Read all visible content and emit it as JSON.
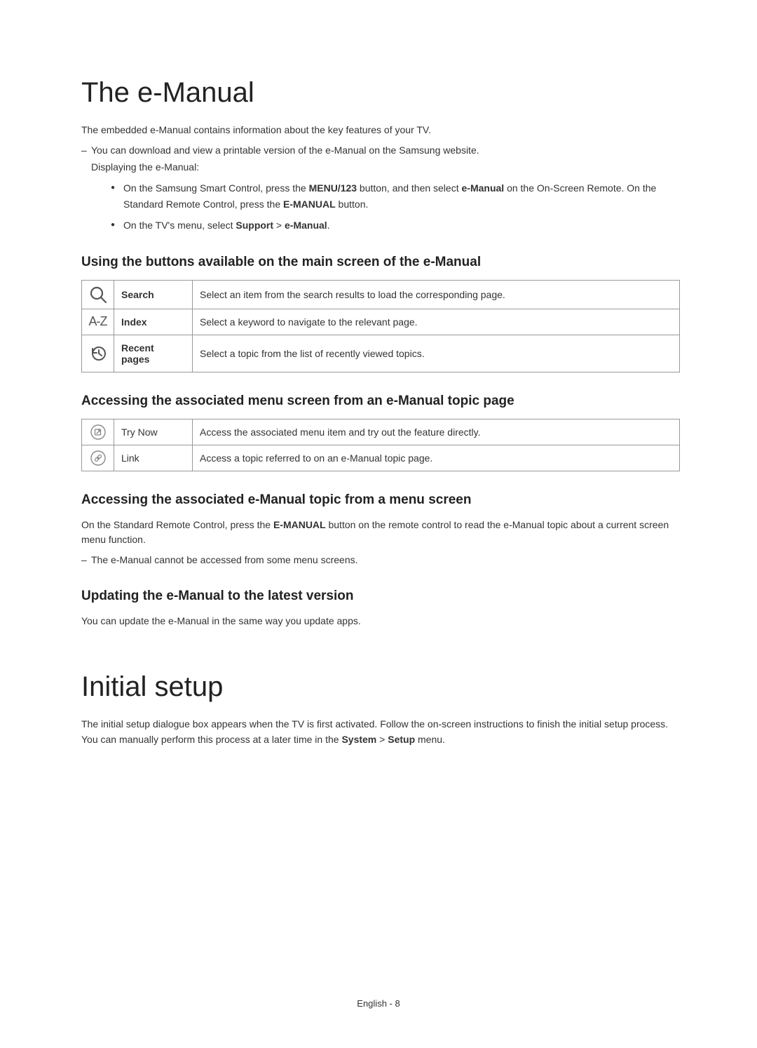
{
  "h1_emanual": "The e-Manual",
  "p_intro": "The embedded e-Manual contains information about the key features of your TV.",
  "dash_download": "You can download and view a printable version of the e-Manual on the Samsung website.",
  "p_displaying": "Displaying the e-Manual:",
  "bullet1_pre": "On the Samsung Smart Control, press the ",
  "bullet1_b1": "MENU/123",
  "bullet1_mid1": " button, and then select ",
  "bullet1_b2": "e-Manual",
  "bullet1_mid2": " on the On-Screen Remote. On the Standard Remote Control, press the ",
  "bullet1_b3": "E-MANUAL",
  "bullet1_end": " button.",
  "bullet2_pre": "On the TV's menu, select ",
  "bullet2_b1": "Support",
  "bullet2_mid": " > ",
  "bullet2_b2": "e-Manual",
  "bullet2_end": ".",
  "h2_buttons": "Using the buttons available on the main screen of the e-Manual",
  "table1": [
    {
      "label": "Search",
      "desc": "Select an item from the search results to load the corresponding page."
    },
    {
      "label": "Index",
      "desc": "Select a keyword to navigate to the relevant page."
    },
    {
      "label": "Recent pages",
      "desc": "Select a topic from the list of recently viewed topics."
    }
  ],
  "index_icon_text": "A-Z",
  "h2_access_menu": "Accessing the associated menu screen from an e-Manual topic page",
  "table2": [
    {
      "label": "Try Now",
      "desc": "Access the associated menu item and try out the feature directly."
    },
    {
      "label": "Link",
      "desc": "Access a topic referred to on an e-Manual topic page."
    }
  ],
  "h2_access_topic": "Accessing the associated e-Manual topic from a menu screen",
  "p_access_pre": "On the Standard Remote Control, press the ",
  "p_access_b": "E-MANUAL",
  "p_access_post": " button on the remote control to read the e-Manual topic about a current screen menu function.",
  "dash_cannot": "The e-Manual cannot be accessed from some menu screens.",
  "h2_update": "Updating the e-Manual to the latest version",
  "p_update": "You can update the e-Manual in the same way you update apps.",
  "h1_initial": "Initial setup",
  "p_initial_pre": "The initial setup dialogue box appears when the TV is first activated. Follow the on-screen instructions to finish the initial setup process. You can manually perform this process at a later time in the ",
  "p_initial_b1": "System",
  "p_initial_mid": " > ",
  "p_initial_b2": "Setup",
  "p_initial_end": " menu.",
  "footer": "English - 8"
}
